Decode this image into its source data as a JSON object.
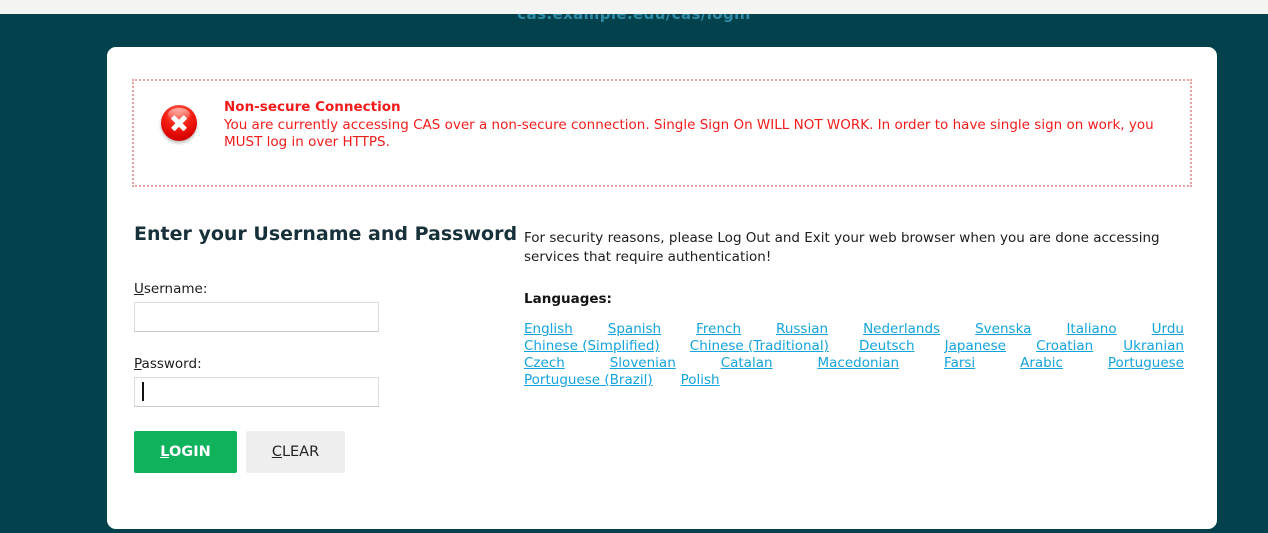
{
  "page": {
    "clipped_header_text": "cas.example.edu/cas/login",
    "background_color": "#03424c",
    "card_background": "#ffffff"
  },
  "alert": {
    "icon": "error-circle-x-icon",
    "title": "Non-secure Connection",
    "body": "You are currently accessing CAS over a non-secure connection. Single Sign On WILL NOT WORK. In order to have single sign on work, you MUST log in over HTTPS.",
    "text_color": "#f21b1b",
    "border_color": "#e8a0a0"
  },
  "login": {
    "heading": "Enter your Username and Password",
    "username": {
      "label_accesskey": "U",
      "label_rest": "sername:",
      "value": "",
      "placeholder": ""
    },
    "password": {
      "label_accesskey": "P",
      "label_rest": "assword:",
      "value": "",
      "placeholder": "",
      "focused": true
    },
    "login_button": {
      "accesskey": "L",
      "rest": "OGIN",
      "color": "#11b25c",
      "text_color": "#ffffff"
    },
    "clear_button": {
      "accesskey": "C",
      "rest": "LEAR",
      "color": "#eeeeee",
      "text_color": "#232323"
    }
  },
  "info": {
    "security_notice": "For security reasons, please Log Out and Exit your web browser when you are done accessing services that require authentication!",
    "languages_heading": "Languages:",
    "link_color": "#14a3dc",
    "language_rows": [
      [
        "English",
        "Spanish",
        "French",
        "Russian",
        "Nederlands",
        "Svenska",
        "Italiano",
        "Urdu"
      ],
      [
        "Chinese (Simplified)",
        "Chinese (Traditional)",
        "Deutsch",
        "Japanese",
        "Croatian",
        "Ukranian"
      ],
      [
        "Czech",
        "Slovenian",
        "Catalan",
        "Macedonian",
        "Farsi",
        "Arabic",
        "Portuguese"
      ],
      [
        "Portuguese (Brazil)",
        "Polish"
      ]
    ]
  }
}
